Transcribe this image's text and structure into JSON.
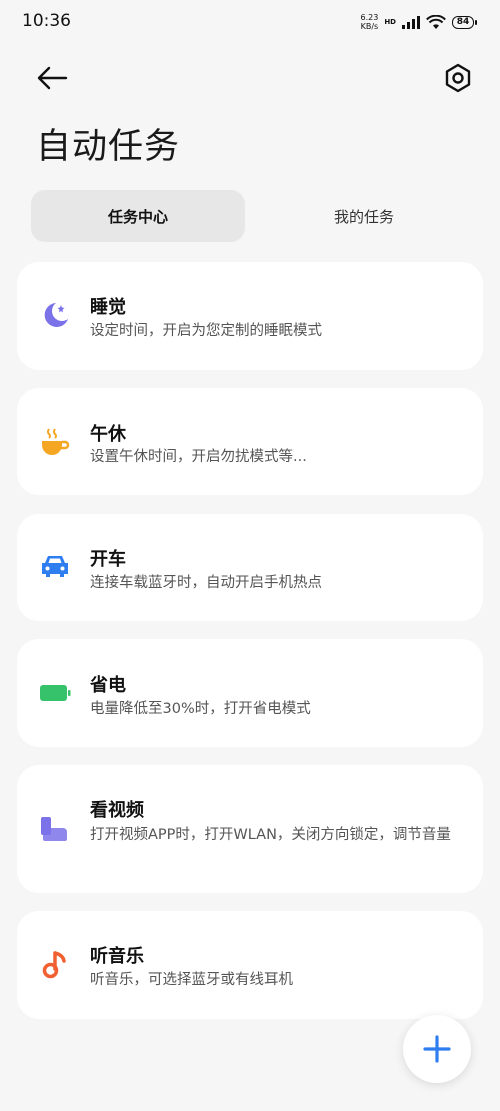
{
  "status_bar": {
    "time": "10:36",
    "net_speed_value": "6.23",
    "net_speed_unit": "KB/s",
    "hd_label": "HD",
    "battery_level": "84"
  },
  "header": {
    "title": "自动任务"
  },
  "tabs": [
    {
      "label": "任务中心",
      "active": true
    },
    {
      "label": "我的任务",
      "active": false
    }
  ],
  "tasks": [
    {
      "title": "睡觉",
      "description": "设定时间，开启为您定制的睡眠模式",
      "icon": "moon-icon",
      "color": "#7b72e9"
    },
    {
      "title": "午休",
      "description": "设置午休时间，开启勿扰模式等...",
      "icon": "coffee-icon",
      "color": "#f5a623"
    },
    {
      "title": "开车",
      "description": "连接车载蓝牙时，自动开启手机热点",
      "icon": "car-icon",
      "color": "#2f7ef0"
    },
    {
      "title": "省电",
      "description": "电量降低至30%时，打开省电模式",
      "icon": "battery-icon",
      "color": "#36c26a"
    },
    {
      "title": "看视频",
      "description": "打开视频APP时，打开WLAN，关闭方向锁定，调节音量",
      "icon": "video-icon",
      "color": "#7b72e9"
    },
    {
      "title": "听音乐",
      "description": "听音乐，可选择蓝牙或有线耳机",
      "icon": "music-note-icon",
      "color": "#f06030"
    }
  ],
  "colors": {
    "background": "#f6f6f6",
    "card": "#ffffff",
    "accent": "#2f7ef0"
  }
}
